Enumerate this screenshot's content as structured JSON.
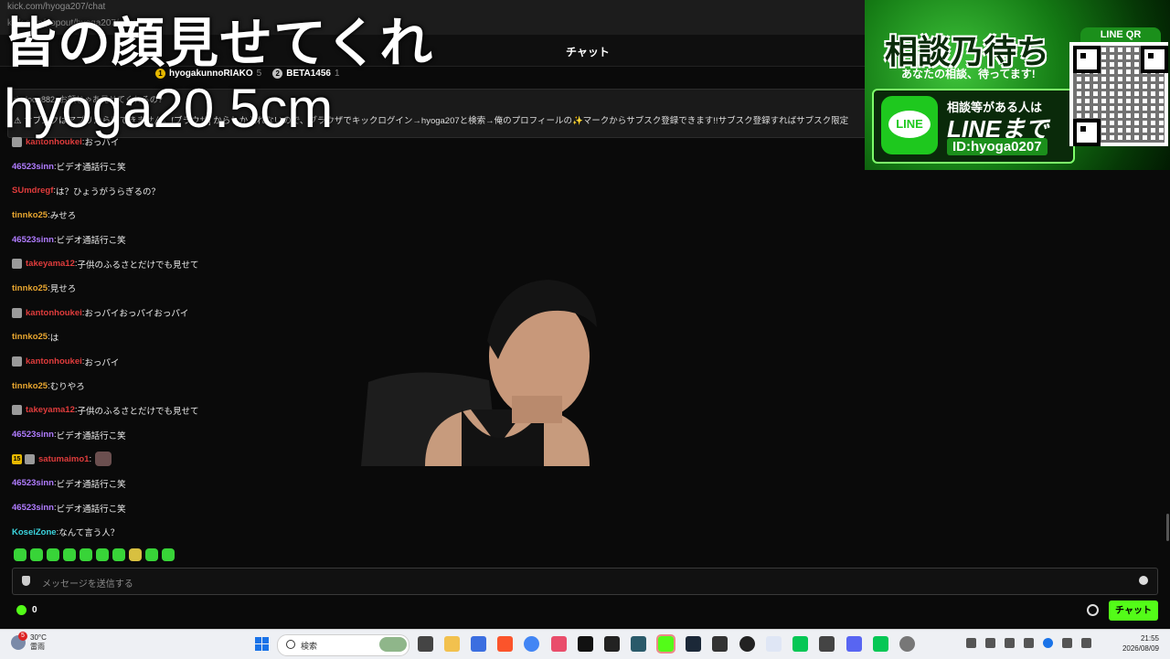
{
  "browser": {
    "tab_text": "kick.com/hyoga207/chat",
    "url_text": "kick.com/popout/hyoga207/chat"
  },
  "chat_header": {
    "title": "チャット"
  },
  "top_gifters": [
    {
      "name": "hyogakunnoRIAKO",
      "count": "5",
      "badge_color": "#e6b800",
      "badge_text": "1"
    },
    {
      "name": "BETA1456",
      "count": "1",
      "badge_color": "#c0c0c0",
      "badge_text": "2"
    }
  ],
  "pinned": {
    "line1": "rindoou882: お顔じゃあ見せてくれるの?",
    "line2": "⚠ サブスクはアプリからはできません。[ブラウザ] からしか入れないので、ブラウザでキックログイン→hyoga207と検索→俺のプロフィールの✨マークからサブスク登録できます!!サブスク登録すればサブスク限定"
  },
  "overlay": {
    "title": "皆の顔見せてくれ",
    "subtitle": "hyoga20.5cm"
  },
  "messages": [
    {
      "user": "kantonhoukei",
      "color": "#e03c3c",
      "text": "おっパイ",
      "avatar": true,
      "badge": ""
    },
    {
      "user": "46523sinn",
      "color": "#b07cff",
      "text": "ビデオ通話行こ笑",
      "avatar": false,
      "badge": ""
    },
    {
      "user": "SUmdregf",
      "color": "#e03c3c",
      "text": "は？ひょうがうらぎるの？",
      "avatar": false,
      "badge": ""
    },
    {
      "user": "tinnko25",
      "color": "#e8a630",
      "text": "みせろ",
      "avatar": false,
      "badge": ""
    },
    {
      "user": "46523sinn",
      "color": "#b07cff",
      "text": "ビデオ通話行こ笑",
      "avatar": false,
      "badge": ""
    },
    {
      "user": "takeyama12",
      "color": "#e03c3c",
      "text": "子供のふるさとだけでも見せて",
      "avatar": true,
      "badge": ""
    },
    {
      "user": "tinnko25",
      "color": "#e8a630",
      "text": "見せろ",
      "avatar": false,
      "badge": ""
    },
    {
      "user": "kantonhoukei",
      "color": "#e03c3c",
      "text": "おっパイおっパイおっパイ",
      "avatar": true,
      "badge": ""
    },
    {
      "user": "tinnko25",
      "color": "#e8a630",
      "text": "は",
      "avatar": false,
      "badge": ""
    },
    {
      "user": "kantonhoukei",
      "color": "#e03c3c",
      "text": "おっパイ",
      "avatar": true,
      "badge": ""
    },
    {
      "user": "tinnko25",
      "color": "#e8a630",
      "text": "むりやろ",
      "avatar": false,
      "badge": ""
    },
    {
      "user": "takeyama12",
      "color": "#e03c3c",
      "text": "子供のふるさとだけでも見せて",
      "avatar": true,
      "badge": ""
    },
    {
      "user": "46523sinn",
      "color": "#b07cff",
      "text": "ビデオ通話行こ笑",
      "avatar": false,
      "badge": ""
    },
    {
      "user": "satumaimo1",
      "color": "#e03c3c",
      "text": "",
      "avatar": true,
      "badge": "15",
      "emote": true
    },
    {
      "user": "46523sinn",
      "color": "#b07cff",
      "text": "ビデオ通話行こ笑",
      "avatar": false,
      "badge": ""
    },
    {
      "user": "46523sinn",
      "color": "#b07cff",
      "text": "ビデオ通話行こ笑",
      "avatar": false,
      "badge": ""
    },
    {
      "user": "KoseiZone",
      "color": "#3cd6e0",
      "text": "なんて言う人？",
      "avatar": false,
      "badge": ""
    }
  ],
  "banner": {
    "headline": "相談乃待ち",
    "tagline": "あなたの相談、待ってます!",
    "line_text1": "相談等がある人は",
    "line_text2": "LINEまで",
    "line_id": "ID:hyoga0207",
    "line_logo": "LINE",
    "qr_label": "LINE QR"
  },
  "chat_input": {
    "placeholder": "メッセージを送信する"
  },
  "points": {
    "value": "0"
  },
  "chat_button": {
    "label": "チャット"
  },
  "taskbar": {
    "weather_temp": "30°C",
    "weather_desc": "雷雨",
    "weather_badge": "5",
    "search_placeholder": "検索",
    "time": "21:55",
    "date": "2026/08/09"
  },
  "colors": {
    "accent": "#53fc18",
    "background": "#0a0a0a"
  }
}
